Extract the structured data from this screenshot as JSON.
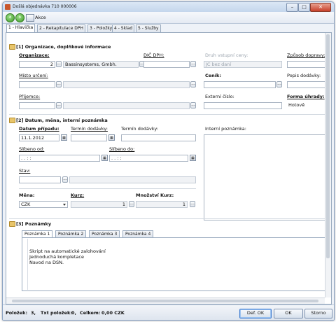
{
  "window": {
    "title": "Došlá objednávka 710 000006",
    "minimize": "–",
    "maximize": "□",
    "close": "✕"
  },
  "toolbar": {
    "back_icon": "‹",
    "forward_icon": "›",
    "akce_label": "Akce"
  },
  "tabs": [
    {
      "label": "1 - Hlavička",
      "active": true
    },
    {
      "label": "2 - Rekapitulace DPH"
    },
    {
      "label": "3 - Položky"
    },
    {
      "label": "4 - Sklad"
    },
    {
      "label": "5 - Služby"
    }
  ],
  "section1": {
    "title": "[1] Organizace, doplňkové informace",
    "organizace_label": "Organizace:",
    "organizace_num": "2",
    "organizace_name": "Bassinsystems, Gmbh.",
    "dic_label": "DIČ DPH:",
    "druh_label": "Druh vstupní ceny:",
    "druh_value": "JC bez daní",
    "zpusob_label": "Způsob dopravy:",
    "misto_label": "Místo určení:",
    "cenik_label": "Ceník:",
    "popis_label": "Popis dodávky:",
    "prijemce_label": "Příjemce:",
    "externi_label": "Externí číslo:",
    "forma_label": "Forma úhrady:",
    "forma_value": "Hotově",
    "dots": "..."
  },
  "section2": {
    "title": "[2] Datum, měna, interní poznámka",
    "datum_label": "Datum případu:",
    "datum_value": "11.1.2012",
    "termin_label": "Termín dodávky:",
    "termin2_label": "Termín dodávky:",
    "interni_label": "Interní poznámka:",
    "slibeno_od_label": "Slíbeno od:",
    "slibeno_od_value": ". .    : :",
    "slibeno_do_label": "Slíbeno do:",
    "slibeno_do_value": ". .    : :",
    "stav_label": "Stav:",
    "mena_label": "Měna:",
    "mena_value": "CZK",
    "kurz_label": "Kurz:",
    "kurz_value": "1",
    "mnozstvi_label": "Množství Kurz:",
    "mnozstvi_value": "1",
    "cal_icon": "▦"
  },
  "section3": {
    "title": "[3] Poznámky",
    "tabs": [
      "Poznámka 1",
      "Poznámka 2",
      "Poznámka 3",
      "Poznámka 4"
    ],
    "note_lines": [
      "Skript na automatické zalohování",
      "Jednoduchá kompletace",
      "Navod na DSN."
    ]
  },
  "status": {
    "polozek_label": "Položek:",
    "polozek_value": "3,",
    "txt_label": "Txt položek:",
    "txt_value": "0,",
    "celkem_label": "Celkem:",
    "celkem_value": "0,00 CZK",
    "def_ok": "Def. OK",
    "ok": "OK",
    "storno": "Storno"
  },
  "colors": {
    "accent": "#3d7bd0",
    "window_border": "#8aa2c2"
  }
}
